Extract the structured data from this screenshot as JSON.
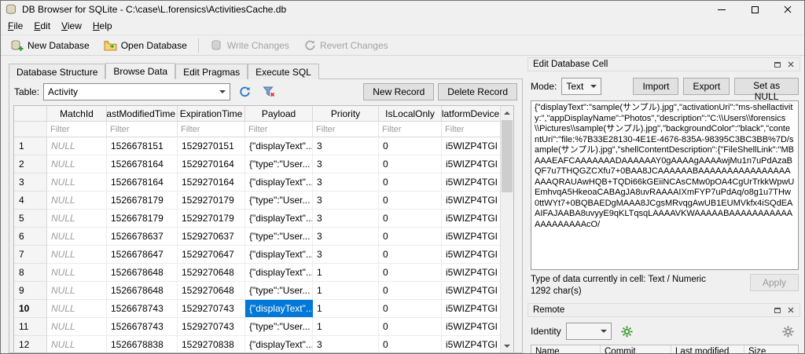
{
  "colors": {
    "selection": "#0078d7",
    "disabled_text": "#a3a3a3"
  },
  "window": {
    "title": "DB Browser for SQLite - C:\\case\\L.forensics\\ActivitiesCache.db"
  },
  "menu": [
    "File",
    "Edit",
    "View",
    "Help"
  ],
  "toolbar": {
    "new_database": "New Database",
    "open_database": "Open Database",
    "write_changes": "Write Changes",
    "revert_changes": "Revert Changes"
  },
  "tabs": [
    "Database Structure",
    "Browse Data",
    "Edit Pragmas",
    "Execute SQL"
  ],
  "browse_controls": {
    "table_label": "Table:",
    "table_value": "Activity",
    "new_record": "New Record",
    "delete_record": "Delete Record"
  },
  "grid": {
    "columns": [
      "MatchId",
      "LastModifiedTime",
      "ExpirationTime",
      "Payload",
      "Priority",
      "IsLocalOnly",
      "PlatformDeviceId"
    ],
    "filter_placeholder": "Filter",
    "rows": [
      {
        "num": "1",
        "cells": [
          "NULL",
          "1526678151",
          "1529270151",
          "{\"displayText\"...",
          "3",
          "0",
          "i5WIZP4TGI"
        ]
      },
      {
        "num": "2",
        "cells": [
          "NULL",
          "1526678164",
          "1529270164",
          "{\"type\":\"User...",
          "3",
          "0",
          "i5WIZP4TGI"
        ]
      },
      {
        "num": "3",
        "cells": [
          "NULL",
          "1526678164",
          "1529270164",
          "{\"displayText\"...",
          "3",
          "0",
          "i5WIZP4TGI"
        ]
      },
      {
        "num": "4",
        "cells": [
          "NULL",
          "1526678179",
          "1529270179",
          "{\"type\":\"User...",
          "3",
          "0",
          "i5WIZP4TGI"
        ]
      },
      {
        "num": "5",
        "cells": [
          "NULL",
          "1526678179",
          "1529270179",
          "{\"displayText\"...",
          "3",
          "0",
          "i5WIZP4TGI"
        ]
      },
      {
        "num": "6",
        "cells": [
          "NULL",
          "1526678637",
          "1529270637",
          "{\"type\":\"User...",
          "3",
          "0",
          "i5WIZP4TGI"
        ]
      },
      {
        "num": "7",
        "cells": [
          "NULL",
          "1526678647",
          "1529270647",
          "{\"displayText\"...",
          "3",
          "0",
          "i5WIZP4TGI"
        ]
      },
      {
        "num": "8",
        "cells": [
          "NULL",
          "1526678648",
          "1529270648",
          "{\"displayText\"...",
          "1",
          "0",
          "i5WIZP4TGI"
        ]
      },
      {
        "num": "9",
        "cells": [
          "NULL",
          "1526678648",
          "1529270648",
          "{\"type\":\"User...",
          "1",
          "0",
          "i5WIZP4TGI"
        ]
      },
      {
        "num": "10",
        "cells": [
          "NULL",
          "1526678743",
          "1529270743",
          "{\"displayText\"...",
          "1",
          "0",
          "i5WIZP4TGI"
        ],
        "bold": true,
        "selected_col": 3
      },
      {
        "num": "11",
        "cells": [
          "NULL",
          "1526678743",
          "1529270743",
          "{\"type\":\"User...",
          "1",
          "0",
          "i5WIZP4TGI"
        ]
      },
      {
        "num": "12",
        "cells": [
          "NULL",
          "1526678838",
          "1529270838",
          "{\"displayText\"...",
          "3",
          "0",
          "i5WIZP4TGI"
        ]
      }
    ]
  },
  "edit_cell": {
    "title": "Edit Database Cell",
    "mode_label": "Mode:",
    "mode_value": "Text",
    "import": "Import",
    "export": "Export",
    "set_as_null": "Set as NULL",
    "content": "{\"displayText\":\"sample(サンプル).jpg\",\"activationUri\":\"ms-shellactivity:\",\"appDisplayName\":\"Photos\",\"description\":\"C:\\\\Users\\\\forensics\\\\Pictures\\\\sample(サンプル).jpg\",\"backgroundColor\":\"black\",\"contentUri\":\"file:%7B33E28130-4E1E-4676-835A-98395C3BC3BB%7D/sample(サンプル).jpg\",\"shellContentDescription\":{\"FileShellLink\":\"MBAAAEAFCAAAAAAADAAAAAAY0gAAAAgAAAAwjMu1n7uPdAzaBQF7u7THQGZCXfu7+0BAA8JCAAAAAABAAAAAAAAAAAAAAAAAAAQRAUAwHQB+TQDi66kGEiiNCAsCMw0pOA4CgUrTrkkWpwUEmhvqA5HkeoaCABAgJA8uvRAAAAIXmFYP7uPdAq/o8g1u7THw0ttWYt7+0BQBAEDgMAAA8JCgsMRvqgAwUB1EUMVkfx4iSQdEAAIFAJAABA8uvyyE9qKLTqsqLAAAAVKWAAAAABAAAAAAAAAAAAAAAAAAAAcO/",
    "type_info": "Type of data currently in cell: Text / Numeric",
    "char_count": "1292 char(s)",
    "apply": "Apply"
  },
  "remote": {
    "title": "Remote",
    "identity_label": "Identity",
    "columns": [
      "Name",
      "Commit",
      "Last modified",
      "Size"
    ]
  }
}
